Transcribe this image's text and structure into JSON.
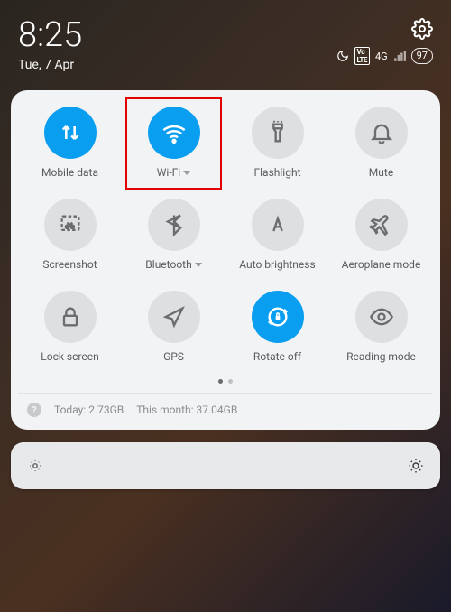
{
  "status": {
    "time": "8:25",
    "date": "Tue, 7 Apr",
    "network_gen": "4G",
    "battery": "97"
  },
  "tiles": {
    "mobile_data": "Mobile data",
    "wifi": "Wi-Fi",
    "flashlight": "Flashlight",
    "mute": "Mute",
    "screenshot": "Screenshot",
    "bluetooth": "Bluetooth",
    "auto_brightness": "Auto brightness",
    "aeroplane_mode": "Aeroplane mode",
    "lock_screen": "Lock screen",
    "gps": "GPS",
    "rotate_off": "Rotate off",
    "reading_mode": "Reading mode"
  },
  "usage": {
    "today_label": "Today:",
    "today_value": "2.73GB",
    "month_label": "This month:",
    "month_value": "37.04GB"
  }
}
